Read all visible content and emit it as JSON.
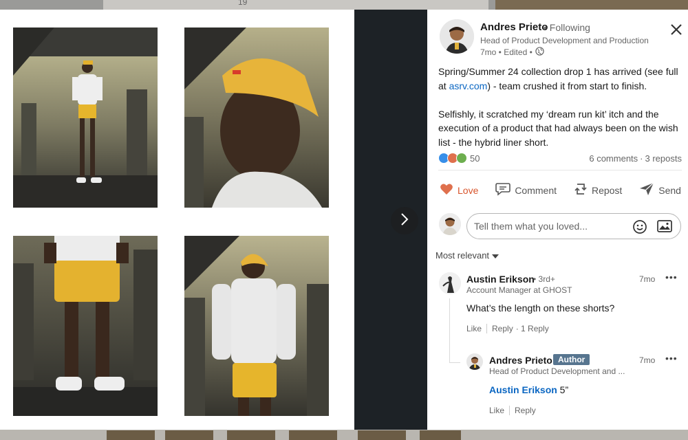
{
  "background": {
    "reaction_count": "19"
  },
  "post": {
    "author": {
      "name": "Andres Prieto",
      "follow_status": "• Following",
      "headline": "Head of Product Development and Production",
      "meta": "7mo • Edited •"
    },
    "text": {
      "para1_before_link": "Spring/Summer 24 collection drop 1 has arrived (see full at ",
      "link": "asrv.com",
      "para1_after_link": ") - team crushed it from start to finish.",
      "para2": "Selfishly, it scratched my ‘dream run kit’ itch and the execution of a product that had always been on the wish list - the hybrid liner short."
    },
    "reactions_count": "50",
    "comments_count": "6 comments",
    "reposts_count": "3 reposts",
    "colors": {
      "love": "#d8542b",
      "link": "#0a66c2",
      "author_badge": "#57758f"
    }
  },
  "actions": {
    "love": "Love",
    "comment": "Comment",
    "repost": "Repost",
    "send": "Send"
  },
  "comment_box": {
    "placeholder": "Tell them what you loved..."
  },
  "sort_label": "Most relevant",
  "comments": [
    {
      "name": "Austin Erikson",
      "degree": "• 3rd+",
      "headline": "Account Manager at GHOST",
      "time": "7mo",
      "text": "What’s the length on these shorts?",
      "like": "Like",
      "reply": "Reply",
      "reply_count": "· 1 Reply"
    },
    {
      "name": "Andres Prieto",
      "badge": "Author",
      "headline": "Head of Product Development and ...",
      "time": "7mo",
      "mention": "Austin Erikson",
      "text": " 5”",
      "like": "Like",
      "reply": "Reply"
    }
  ],
  "icons": {
    "close": "close-icon",
    "next": "chevron-right-icon",
    "globe": "globe-icon",
    "emoji": "emoji-icon",
    "image": "image-icon",
    "more": "more-icon"
  }
}
